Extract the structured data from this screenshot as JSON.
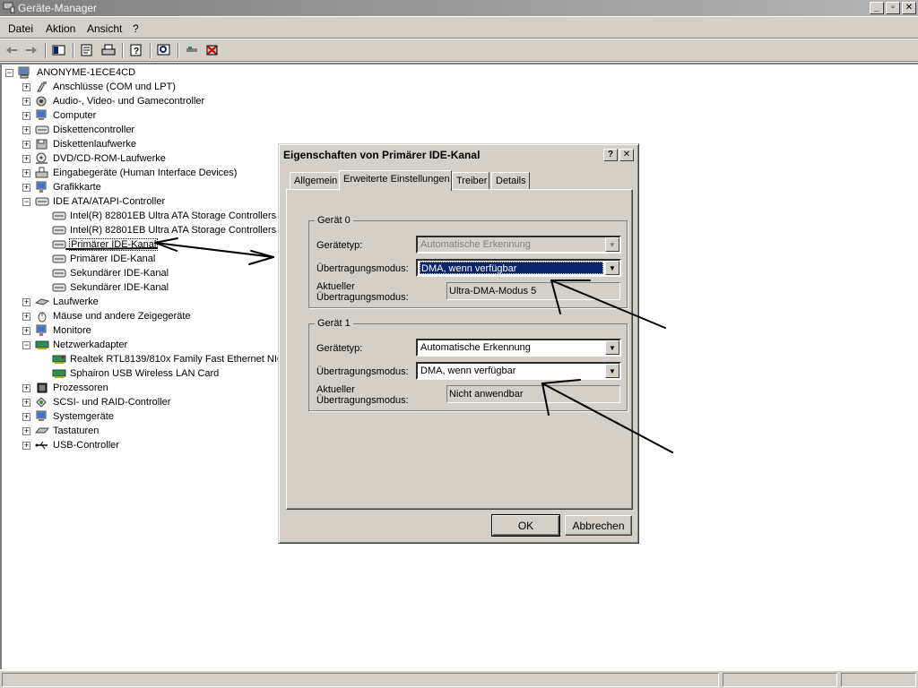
{
  "window": {
    "title": "Geräte-Manager",
    "controls": [
      "_",
      "▫",
      "✕"
    ]
  },
  "menu": [
    "Datei",
    "Aktion",
    "Ansicht",
    "?"
  ],
  "toolbar": {
    "buttons": [
      "back-icon",
      "forward-icon",
      "view-icon",
      "properties-icon",
      "print-icon",
      "help-icon",
      "scan-icon",
      "update-driver-icon",
      "uninstall-icon"
    ]
  },
  "tree": {
    "root": "ANONYME-1ECE4CD",
    "items": [
      "Anschlüsse (COM und LPT)",
      "Audio-, Video- und Gamecontroller",
      "Computer",
      "Diskettencontroller",
      "Diskettenlaufwerke",
      "DVD/CD-ROM-Laufwerke",
      "Eingabegeräte (Human Interface Devices)",
      "Grafikkarte",
      "IDE ATA/ATAPI-Controller",
      "Laufwerke",
      "Mäuse und andere Zeigegeräte",
      "Monitore",
      "Netzwerkadapter",
      "Prozessoren",
      "SCSI- und RAID-Controller",
      "Systemgeräte",
      "Tastaturen",
      "USB-Controller"
    ],
    "ide_children": [
      "Intel(R) 82801EB Ultra ATA Storage Controllers",
      "Intel(R) 82801EB Ultra ATA Storage Controllers",
      "Primärer IDE-Kanal",
      "Primärer IDE-Kanal",
      "Sekundärer IDE-Kanal",
      "Sekundärer IDE-Kanal"
    ],
    "net_children": [
      "Realtek RTL8139/810x Family Fast Ethernet NIC",
      "Sphairon USB Wireless LAN Card"
    ]
  },
  "dialog": {
    "title": "Eigenschaften von Primärer IDE-Kanal",
    "tabs": [
      "Allgemein",
      "Erweiterte Einstellungen",
      "Treiber",
      "Details"
    ],
    "device0": {
      "group": "Gerät 0",
      "type_label": "Gerätetyp:",
      "type_value": "Automatische Erkennung",
      "mode_label": "Übertragungsmodus:",
      "mode_value": "DMA, wenn verfügbar",
      "current_label_1": "Aktueller",
      "current_label_2": "Übertragungsmodus:",
      "current_value": "Ultra-DMA-Modus 5"
    },
    "device1": {
      "group": "Gerät 1",
      "type_label": "Gerätetyp:",
      "type_value": "Automatische Erkennung",
      "mode_label": "Übertragungsmodus:",
      "mode_value": "DMA, wenn verfügbar",
      "current_label_1": "Aktueller",
      "current_label_2": "Übertragungsmodus:",
      "current_value": "Nicht anwendbar"
    },
    "ok": "OK",
    "cancel": "Abbrechen",
    "help_btn": "?",
    "close_btn": "✕"
  },
  "colors": {
    "face": "#d4d0c8",
    "selection": "#0a246a",
    "title_inactive": "#808080"
  }
}
